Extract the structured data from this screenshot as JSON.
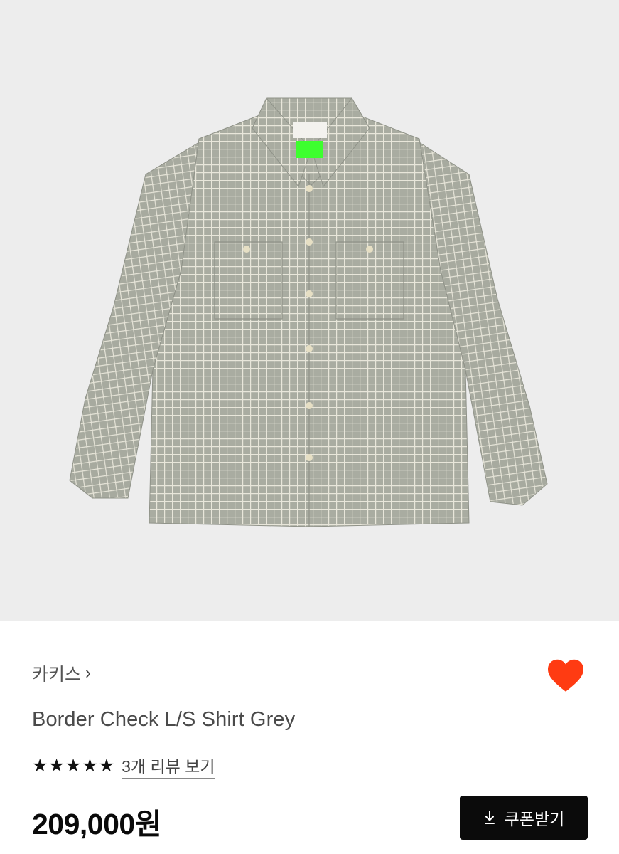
{
  "product": {
    "image_alt": "Border Check L/S Shirt Grey product photo",
    "label_color": "#3dff2e"
  },
  "brand": {
    "name": "카키스",
    "chevron": "›"
  },
  "favorite": {
    "icon": "heart-icon",
    "active": true,
    "color": "#ff3b12"
  },
  "title": "Border Check L/S Shirt Grey",
  "rating": {
    "stars": 5,
    "review_link": "3개 리뷰 보기"
  },
  "price": "209,000원",
  "coupon_button": {
    "icon": "download-icon",
    "label": "쿠폰받기"
  }
}
